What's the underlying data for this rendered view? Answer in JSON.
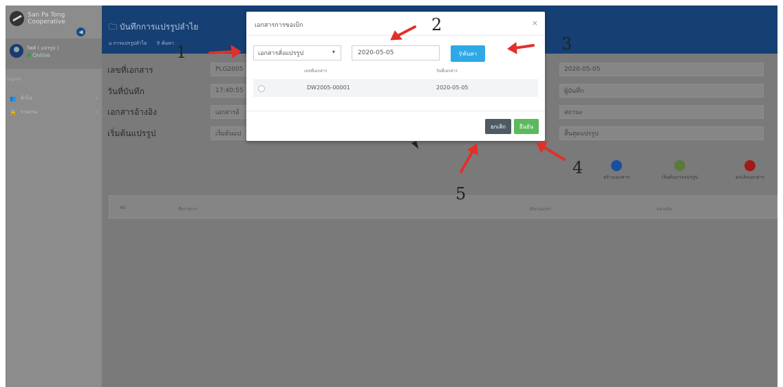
{
  "sidebar": {
    "brand": "San Pa Tong Cooperative",
    "user_name": "กิตติ ( แปรรูป )",
    "user_status": "Online",
    "menu_header": "เมนูหลัก",
    "items": [
      {
        "label": "ทั่วไป",
        "icon": "users-icon"
      },
      {
        "label": "รายงาน",
        "icon": "lock-icon"
      }
    ]
  },
  "header": {
    "title": "บันทึกการแปรรูปลำไย",
    "tabs": [
      "การแปรรูปลำไย",
      "ค้นหา"
    ]
  },
  "form": {
    "doc_no_label": "เลขที่เอกสาร",
    "doc_no_value": "PLG2005",
    "record_date_label": "วันที่บันทึก",
    "record_time_value": "17:40:55",
    "ref_doc_label": "เอกสารอ้างอิง",
    "ref_doc_value": "เอกสารอ้",
    "start_label": "เริ่มต้นแปรรูป",
    "start_value": "เริ่มต้นแป",
    "right_date_value": "2020-05-05",
    "recorder_value": "ผู้บันทึก",
    "status_value": "สถานะ",
    "end_value": "สิ้นสุดแปรรูป"
  },
  "actions": [
    {
      "label": "สร้างเอกสาร",
      "color": "#1a4fa0"
    },
    {
      "label": "เริ่มต้นการแปรรูป",
      "color": "#5a7a3a"
    },
    {
      "label": "ยกเลิกเอกสาร",
      "color": "#a01a1a"
    }
  ],
  "table": {
    "columns": [
      "NO",
      "ชื่อรายการ",
      "ปริมาณ(กก)",
      "หน่วยนับ"
    ]
  },
  "modal": {
    "title": "เอกสารการขอเบิก",
    "close": "×",
    "select_value": "เอกสารสั่งแปรรูป",
    "date_value": "2020-05-05",
    "search_label": "ค้นหา",
    "col_doc_no": "เลขที่เอกสาร",
    "col_doc_date": "วันที่เอกสาร",
    "rows": [
      {
        "doc_no": "DW2005-00001",
        "doc_date": "2020-05-05"
      }
    ],
    "cancel_label": "ยกเลิก",
    "confirm_label": "ยืนยัน"
  },
  "annotations": [
    "1",
    "2",
    "3",
    "4",
    "5"
  ],
  "colors": {
    "header": "#163f73",
    "search_button": "#2fa8e6",
    "confirm_button": "#5cb85c",
    "cancel_button": "#4e5b63",
    "arrow": "#e0302a"
  }
}
